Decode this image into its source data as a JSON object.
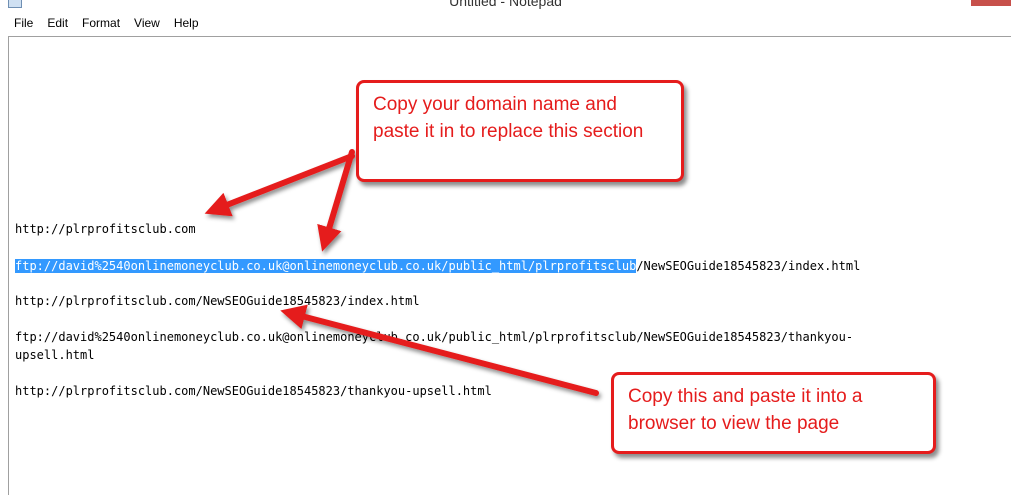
{
  "window": {
    "title": "Untitled - Notepad"
  },
  "menu": [
    "File",
    "Edit",
    "Format",
    "View",
    "Help"
  ],
  "lines": [
    {
      "text": "http://plrprofitsclub.com"
    },
    {
      "selected": "ftp://david%2540onlinemoneyclub.co.uk@onlinemoneyclub.co.uk/public_html/plrprofitsclub",
      "rest": "/NewSEOGuide18545823/index.html"
    },
    {
      "text": "http://plrprofitsclub.com/NewSEOGuide18545823/index.html"
    },
    {
      "text": "ftp://david%2540onlinemoneyclub.co.uk@onlinemoneyclub.co.uk/public_html/plrprofitsclub/NewSEOGuide18545823/thankyou-"
    },
    {
      "text": "upsell.html"
    },
    {
      "text": "http://plrprofitsclub.com/NewSEOGuide18545823/thankyou-upsell.html"
    }
  ],
  "callouts": {
    "top": [
      "Copy your domain name and",
      "paste it in to replace this section"
    ],
    "bottom": [
      "Copy this and paste it into a",
      "browser to view the page"
    ]
  },
  "colors": {
    "annotation_red": "#e51c1c",
    "selection_blue": "#3399ff"
  }
}
